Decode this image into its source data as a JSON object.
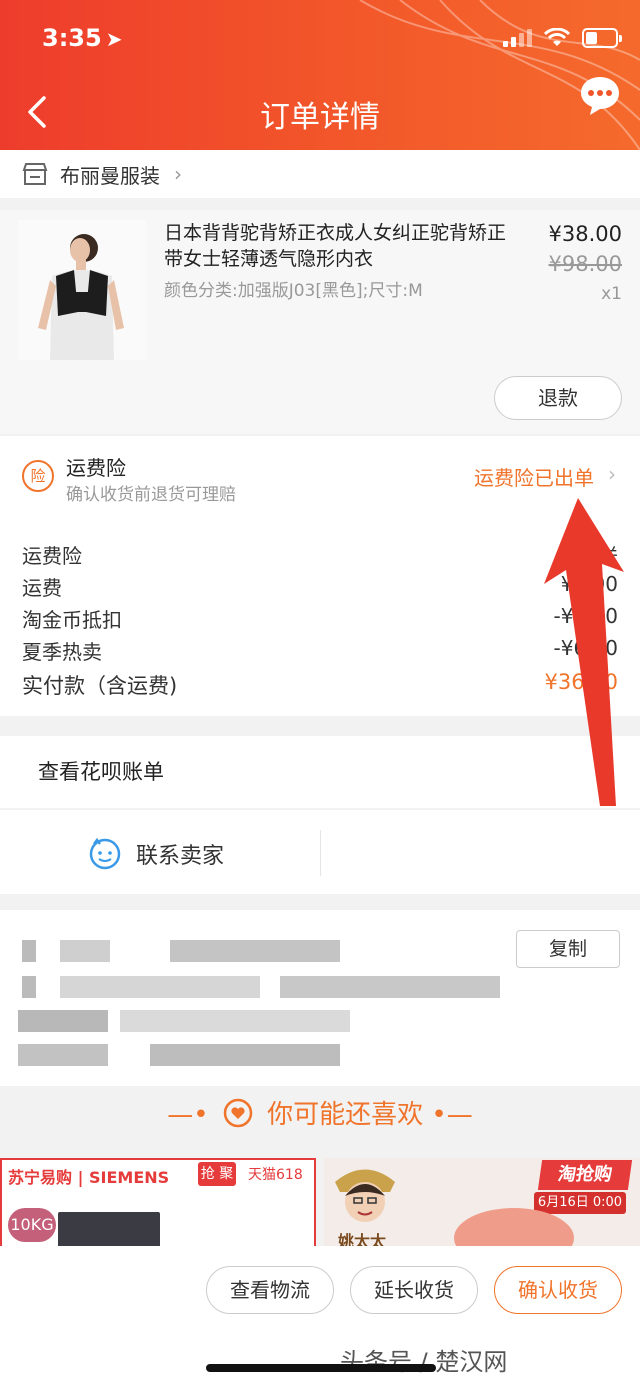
{
  "status_bar": {
    "time": "3:35",
    "location_glyph": "➤"
  },
  "header": {
    "title": "订单详情"
  },
  "shop": {
    "name": "布丽曼服装"
  },
  "product": {
    "title": "日本背背驼背矫正衣成人女纠正驼背矫正带女士轻薄透气隐形内衣",
    "spec": "颜色分类:加强版J03[黑色];尺寸:M",
    "price": "¥38.00",
    "original_price": "¥98.00",
    "quantity": "x1",
    "refund_label": "退款"
  },
  "insurance": {
    "icon_text": "险",
    "title": "运费险",
    "subtitle": "确认收货前退货可理赔",
    "status": "运费险已出单"
  },
  "fees": {
    "rows": [
      {
        "label": "运费险",
        "value": "卖家送"
      },
      {
        "label": "运费",
        "value": "¥0.00"
      },
      {
        "label": "淘金币抵扣",
        "value": "-¥0.00"
      },
      {
        "label": "夏季热卖",
        "value": "-¥6.00"
      }
    ],
    "total_label": "实付款（含运费)",
    "total_value": "¥36.00"
  },
  "huabei": {
    "label": "查看花呗账单"
  },
  "contact": {
    "label": "联系卖家"
  },
  "order_info": {
    "copy_label": "复制"
  },
  "recommend": {
    "title": "你可能还喜欢"
  },
  "recs": [
    {
      "brand": "苏宁易购 | SIEMENS",
      "tag": "10KG",
      "badge": "抢 聚",
      "sub": "天猫618"
    },
    {
      "brand": "姚太太",
      "badge": "淘抢购",
      "date": "6月16日 0:00"
    }
  ],
  "actions": {
    "logistics": "查看物流",
    "extend": "延长收货",
    "confirm": "确认收货"
  },
  "watermark": "头条号 / 楚汉网",
  "colors": {
    "accent": "#f0742b",
    "header_start": "#ee3c2c",
    "header_end": "#f56a2c",
    "arrow": "#e8392b"
  }
}
